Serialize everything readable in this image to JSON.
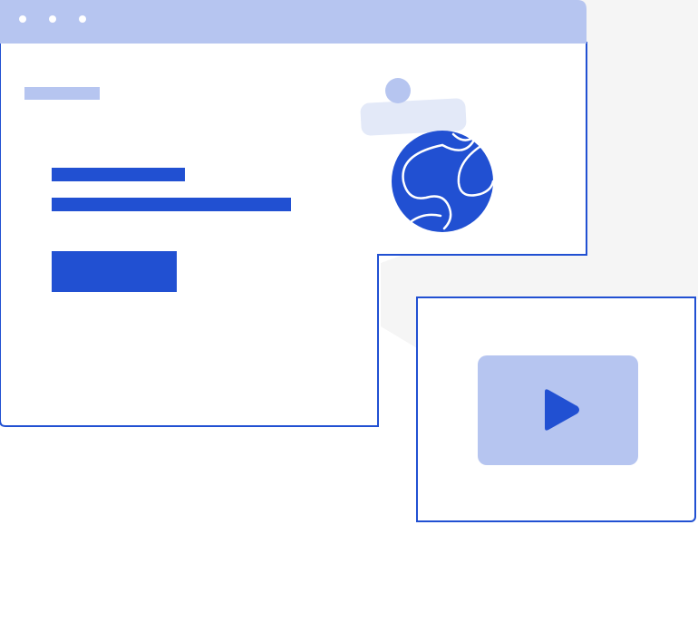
{
  "illustration": {
    "theme": {
      "accent": "#2150d2",
      "soft_accent": "#b6c5f0",
      "pale_accent": "#e3e9f8",
      "backdrop": "#f5f5f5",
      "surface": "#ffffff"
    },
    "browser_window": {
      "titlebar_dots": [
        "dot",
        "dot",
        "dot"
      ],
      "content_placeholders": [
        "tag-placeholder",
        "heading-line-placeholder",
        "text-line-placeholder",
        "button-placeholder"
      ],
      "icons": [
        "globe-icon",
        "avatar-icon"
      ]
    },
    "video_card": {
      "icon": "play-icon"
    }
  }
}
